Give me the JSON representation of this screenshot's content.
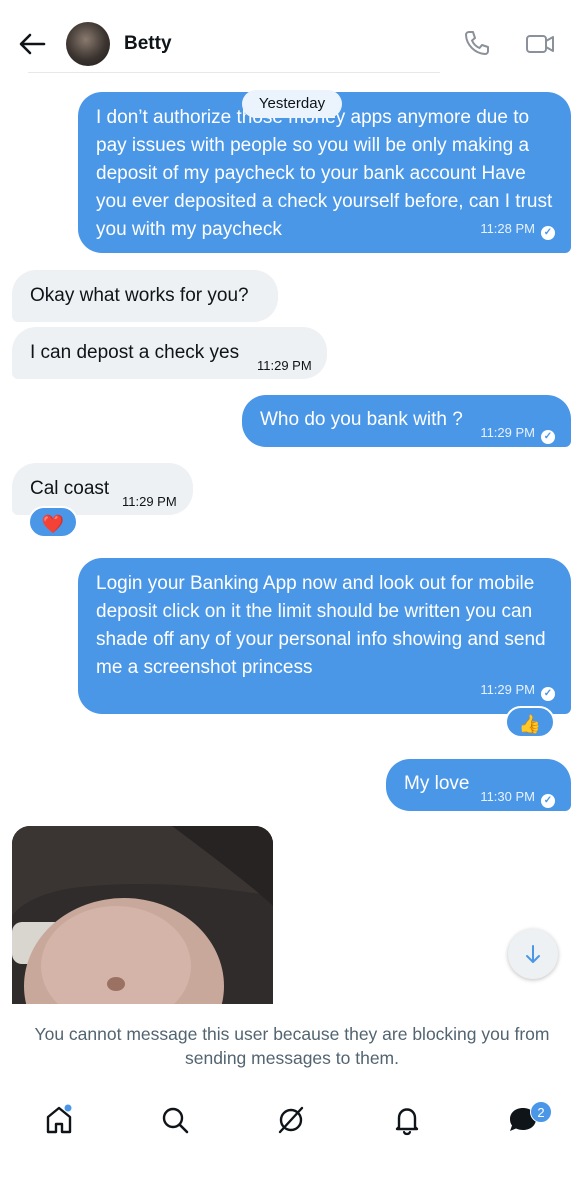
{
  "header": {
    "contact_name": "Betty"
  },
  "date_separator": "Yesterday",
  "messages": [
    {
      "direction": "out",
      "text": "I don’t authorize those money apps anymore due to pay issues with people so you will be only making a deposit of my paycheck to your bank account Have you ever deposited a check yourself before, can I trust you with my paycheck",
      "time": "11:28 PM"
    },
    {
      "direction": "in",
      "text": "Okay what works for you?",
      "time": ""
    },
    {
      "direction": "in",
      "text": "I can depost a check yes",
      "time": "11:29 PM"
    },
    {
      "direction": "out",
      "text": "Who do you bank with ?",
      "time": "11:29 PM"
    },
    {
      "direction": "in",
      "text": "Cal coast",
      "time": "11:29 PM",
      "reaction": "❤️"
    },
    {
      "direction": "out",
      "text": "Login your Banking App now and look out for mobile deposit click on it the limit should be written you can shade off any of your personal info showing and send me a screenshot princess",
      "time": "11:29 PM",
      "reaction": "👍"
    },
    {
      "direction": "out",
      "text": "My love",
      "time": "11:30 PM"
    }
  ],
  "blocked_notice": "You cannot message this user because they are blocking you from sending messages to them.",
  "nav": {
    "items": [
      "home-icon",
      "search-icon",
      "grok-icon",
      "notifications-icon",
      "messages-icon"
    ],
    "messages_badge": "2"
  },
  "colors": {
    "accent": "#4a97e8",
    "incoming_bg": "#eef1f3",
    "secondary_text": "#536471"
  }
}
